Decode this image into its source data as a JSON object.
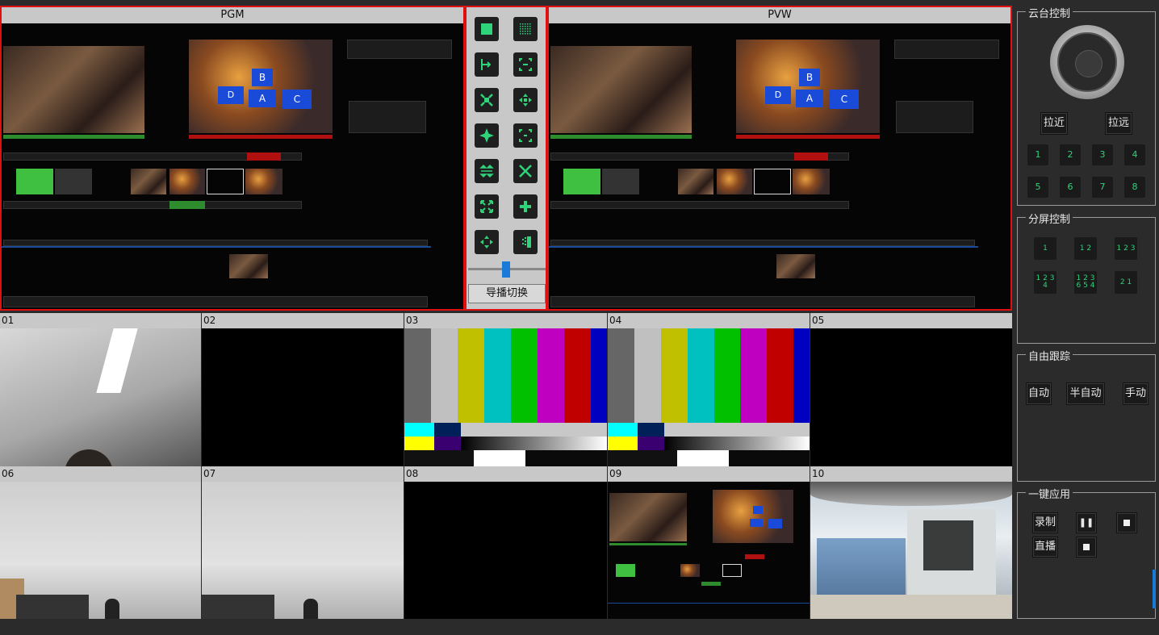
{
  "pgm": {
    "title": "PGM"
  },
  "pvw": {
    "title": "PVW"
  },
  "transition": {
    "switch_label": "导播切换"
  },
  "sources": [
    {
      "label": "01"
    },
    {
      "label": "02"
    },
    {
      "label": "03"
    },
    {
      "label": "04"
    },
    {
      "label": "05"
    },
    {
      "label": "06"
    },
    {
      "label": "07"
    },
    {
      "label": "08"
    },
    {
      "label": "09"
    },
    {
      "label": "10"
    }
  ],
  "mock": {
    "tile_b": "B",
    "tile_a": "A",
    "tile_c": "C",
    "tile_d": "D"
  },
  "ptz": {
    "title": "云台控制",
    "zoom_in": "拉近",
    "zoom_out": "拉远",
    "presets": [
      "1",
      "2",
      "3",
      "4",
      "5",
      "6",
      "7",
      "8"
    ]
  },
  "split": {
    "title": "分屏控制",
    "layouts": [
      "1",
      "1 2",
      "1 2 3",
      "1 2 3 4",
      "1 2 3 6 5 4",
      "2 1"
    ]
  },
  "tracking": {
    "title": "自由跟踪",
    "auto": "自动",
    "semi": "半自动",
    "manual": "手动"
  },
  "onekey": {
    "title": "一键应用",
    "record": "录制",
    "live": "直播"
  },
  "colors": {
    "accent_red": "#e01010",
    "icon_green": "#2ed37a"
  }
}
